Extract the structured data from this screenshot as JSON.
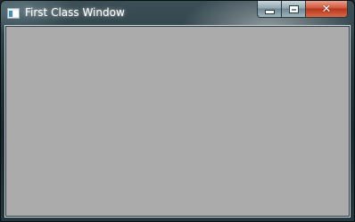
{
  "window": {
    "title": "First Class Window",
    "icon": "application-icon",
    "controls": {
      "minimize_icon": "minimize-icon",
      "maximize_icon": "maximize-icon",
      "close_icon": "close-icon"
    }
  },
  "client_area": {
    "background_color": "#ababab"
  }
}
